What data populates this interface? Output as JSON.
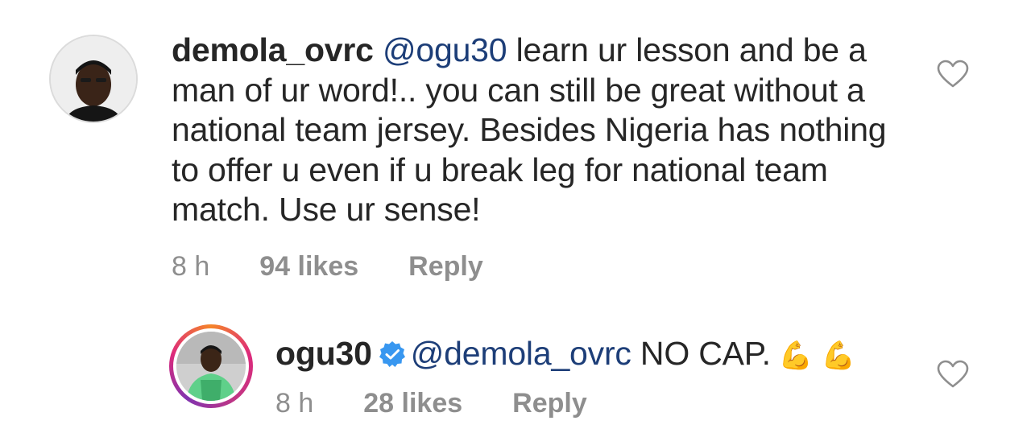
{
  "comments": [
    {
      "username": "demola_ovrc",
      "mention": "@ogu30",
      "text": "learn ur lesson and be a man of ur word!.. you can still be great without a national team jersey. Besides Nigeria has nothing to offer u even if u break leg for national team match. Use ur sense!",
      "time": "8 h",
      "likes": "94 likes",
      "reply_label": "Reply",
      "verified": false
    },
    {
      "username": "ogu30",
      "mention": "@demola_ovrc",
      "text": "NO CAP.",
      "emojis": "💪 💪",
      "time": "8 h",
      "likes": "28 likes",
      "reply_label": "Reply",
      "verified": true
    }
  ],
  "colors": {
    "text": "#262626",
    "mention": "#1d3e78",
    "meta": "#8e8e8e",
    "verified": "#3897f0",
    "story_ring_start": "#f58529",
    "story_ring_end": "#8134af"
  },
  "icons": {
    "like": "heart-outline-icon",
    "verified": "verified-badge-icon"
  }
}
